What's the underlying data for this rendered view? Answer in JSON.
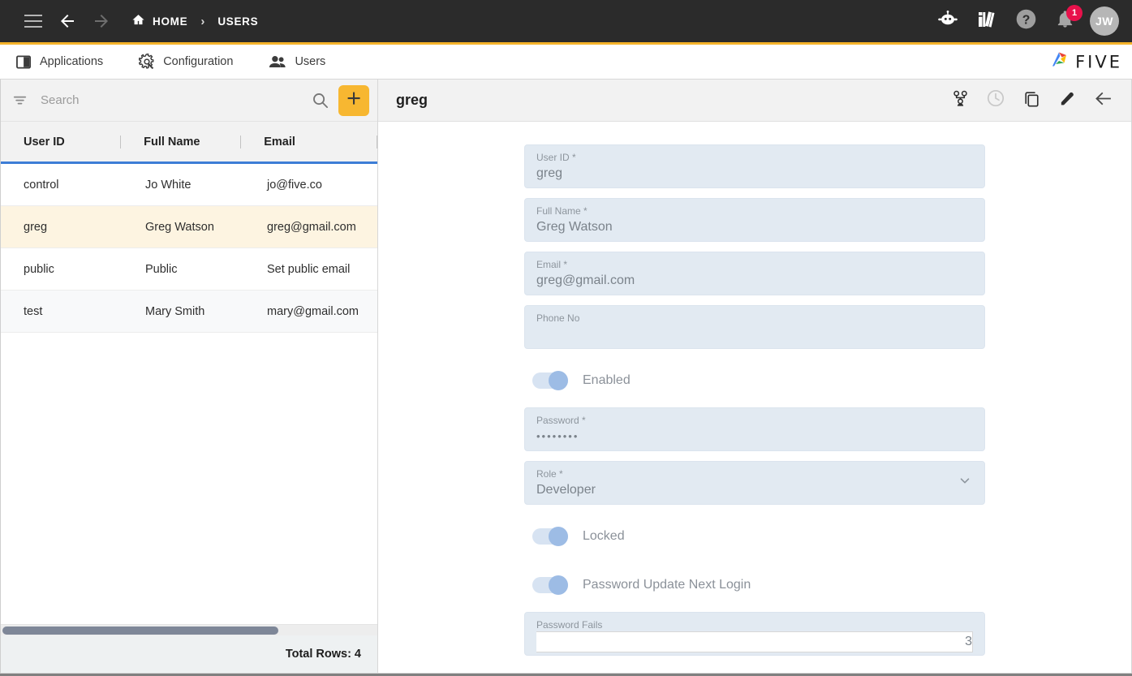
{
  "topnav": {
    "menu_icon": "hamburger-icon",
    "back_icon": "arrow-left-icon",
    "forward_icon": "arrow-right-icon",
    "home_icon": "home-icon",
    "breadcrumbs": [
      {
        "label": "HOME",
        "icon": "home-icon"
      },
      {
        "label": "USERS",
        "icon": null
      }
    ],
    "separator": "›",
    "right_icons": [
      {
        "name": "chat-bot-icon"
      },
      {
        "name": "books-library-icon"
      },
      {
        "name": "help-circle-icon"
      },
      {
        "name": "bell-notifications-icon"
      }
    ],
    "notification_count": "1",
    "avatar_initials": "JW",
    "bg_color": "#2b2b2b",
    "accent_color": "#f5b32a"
  },
  "tabbar": {
    "tabs": [
      {
        "label": "Applications",
        "icon": "applications-panel-icon"
      },
      {
        "label": "Configuration",
        "icon": "configuration-gear-icon"
      },
      {
        "label": "Users",
        "icon": "users-people-icon"
      }
    ],
    "brand": "FIVE",
    "brand_icon": "five-logo-icon"
  },
  "list_panel": {
    "search": {
      "placeholder": "Search",
      "value": "",
      "filter_icon": "filter-icon",
      "search_icon": "search-icon"
    },
    "add_button": {
      "label": "+",
      "icon": "plus-icon",
      "color": "#f7b731"
    },
    "columns": [
      "User ID",
      "Full Name",
      "Email"
    ],
    "rows": [
      {
        "user_id": "control",
        "full_name": "Jo White",
        "email": "jo@five.co"
      },
      {
        "user_id": "greg",
        "full_name": "Greg Watson",
        "email": "greg@gmail.com"
      },
      {
        "user_id": "public",
        "full_name": "Public",
        "email": "Set public email"
      },
      {
        "user_id": "test",
        "full_name": "Mary Smith",
        "email": "mary@gmail.com"
      }
    ],
    "selected_row_index": 1,
    "footer": "Total Rows: 4",
    "header_underline_color": "#3d7dd6",
    "selected_row_color": "#fdf4e1"
  },
  "detail_panel": {
    "title": "greg",
    "actions": [
      {
        "name": "user-roles-icon"
      },
      {
        "name": "history-clock-icon"
      },
      {
        "name": "duplicate-copy-icon"
      },
      {
        "name": "edit-pencil-icon"
      },
      {
        "name": "back-arrow-icon"
      }
    ],
    "fields": [
      {
        "label": "User ID",
        "required": true,
        "value": "greg",
        "type": "text"
      },
      {
        "label": "Full Name",
        "required": true,
        "value": "Greg Watson",
        "type": "text"
      },
      {
        "label": "Email",
        "required": true,
        "value": "greg@gmail.com",
        "type": "text"
      },
      {
        "label": "Phone No",
        "required": false,
        "value": "",
        "type": "text"
      },
      {
        "label": "Password",
        "required": true,
        "value": "••••••••",
        "type": "password"
      },
      {
        "label": "Role",
        "required": true,
        "value": "Developer",
        "type": "select"
      },
      {
        "label": "Password Fails",
        "required": false,
        "value": "3",
        "type": "number"
      }
    ],
    "toggles": [
      {
        "label": "Enabled",
        "on": true
      },
      {
        "label": "Locked",
        "on": true
      },
      {
        "label": "Password Update Next Login",
        "on": true
      }
    ]
  }
}
